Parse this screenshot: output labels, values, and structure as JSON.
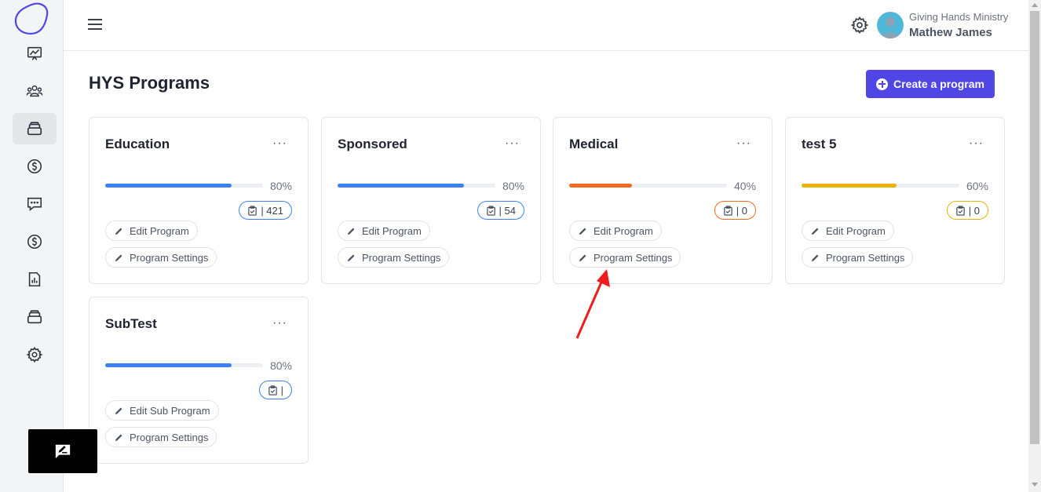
{
  "header": {
    "org_name": "Giving Hands Ministry",
    "user_name": "Mathew James"
  },
  "sidebar": {
    "items": [
      {
        "icon": "chart-line-icon"
      },
      {
        "icon": "users-group-icon"
      },
      {
        "icon": "stack-icon",
        "active": true
      },
      {
        "icon": "dollar-circle-icon"
      },
      {
        "icon": "chat-message-icon"
      },
      {
        "icon": "dollar-circle-icon"
      },
      {
        "icon": "report-icon"
      },
      {
        "icon": "stack-icon"
      },
      {
        "icon": "gear-icon"
      }
    ]
  },
  "main": {
    "title": "HYS Programs",
    "create_label": "Create a program",
    "accent_color": "#4f46e5"
  },
  "programs": [
    {
      "name": "Education",
      "percent_label": "80%",
      "progress": 0.8,
      "color": "#3b82f6",
      "count": "| 421",
      "edit_label": "Edit Program",
      "settings_label": "Program Settings"
    },
    {
      "name": "Sponsored",
      "percent_label": "80%",
      "progress": 0.8,
      "color": "#3b82f6",
      "count": "| 54",
      "edit_label": "Edit Program",
      "settings_label": "Program Settings"
    },
    {
      "name": "Medical",
      "percent_label": "40%",
      "progress": 0.4,
      "color": "#f26b1d",
      "count": "| 0",
      "edit_label": "Edit Program",
      "settings_label": "Program Settings"
    },
    {
      "name": "test 5",
      "percent_label": "60%",
      "progress": 0.6,
      "color": "#eab308",
      "count": "| 0",
      "edit_label": "Edit Program",
      "settings_label": "Program Settings"
    },
    {
      "name": "SubTest",
      "percent_label": "80%",
      "progress": 0.8,
      "color": "#3b82f6",
      "count": "|",
      "edit_label": "Edit Sub Program",
      "settings_label": "Program Settings"
    }
  ]
}
